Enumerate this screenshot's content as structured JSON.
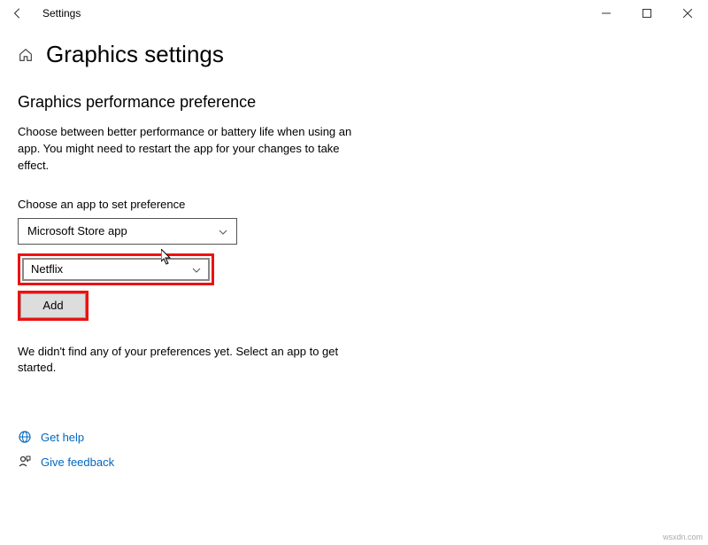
{
  "titlebar": {
    "title": "Settings"
  },
  "header": {
    "page_title": "Graphics settings"
  },
  "section": {
    "heading": "Graphics performance preference",
    "description": "Choose between better performance or battery life when using an app. You might need to restart the app for your changes to take effect.",
    "choose_label": "Choose an app to set preference"
  },
  "dropdowns": {
    "app_type": "Microsoft Store app",
    "app_select": "Netflix"
  },
  "buttons": {
    "add": "Add"
  },
  "empty_state": "We didn't find any of your preferences yet. Select an app to get started.",
  "links": {
    "help": "Get help",
    "feedback": "Give feedback"
  },
  "watermark": "wsxdn.com"
}
